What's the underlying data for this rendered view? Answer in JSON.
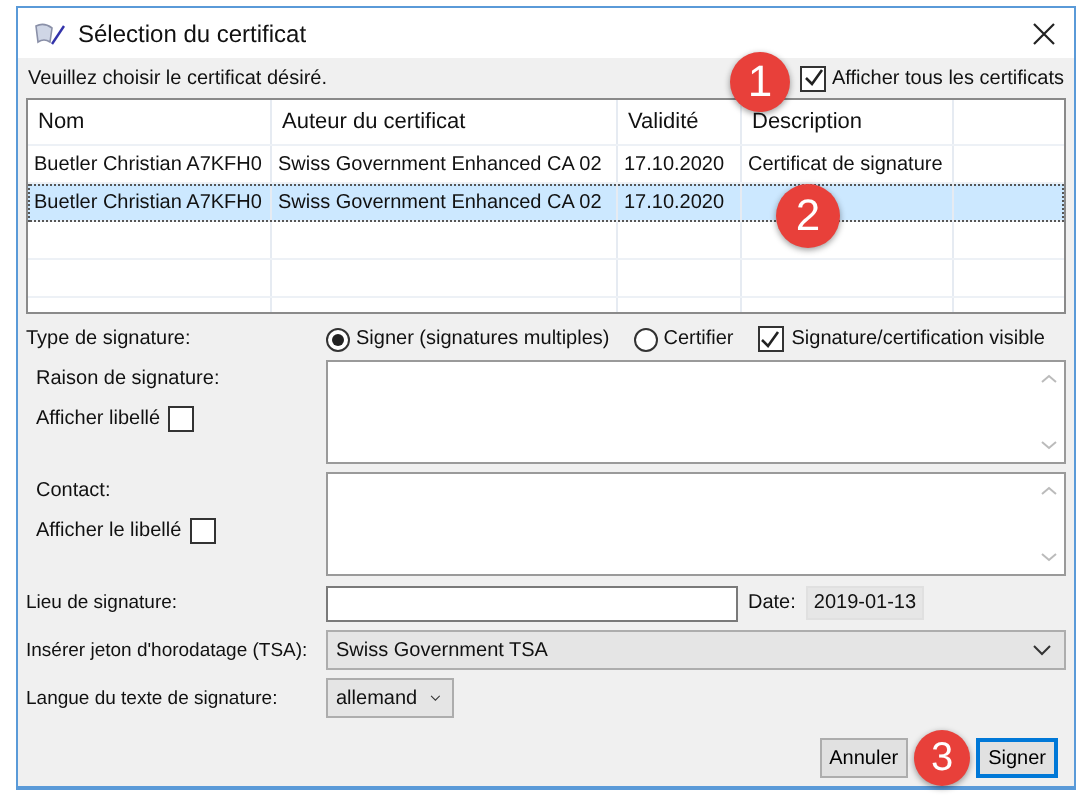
{
  "window": {
    "title": "Sélection du certificat"
  },
  "instruction": "Veuillez choisir le certificat désiré.",
  "show_all": {
    "label": "Afficher tous les certificats",
    "checked": true
  },
  "table": {
    "columns": [
      "Nom",
      "Auteur du certificat",
      "Validité",
      "Description"
    ],
    "rows": [
      {
        "cells": [
          "Buetler Christian A7KFH0",
          "Swiss Government Enhanced CA 02",
          "17.10.2020",
          "Certificat de signature"
        ],
        "selected": false
      },
      {
        "cells": [
          "Buetler Christian A7KFH0",
          "Swiss Government Enhanced CA 02",
          "17.10.2020",
          ""
        ],
        "selected": true
      }
    ]
  },
  "signature_type": {
    "label": "Type de signature:",
    "options": [
      {
        "label": "Signer (signatures multiples)",
        "selected": true
      },
      {
        "label": "Certifier",
        "selected": false
      }
    ],
    "visible": {
      "label": "Signature/certification visible",
      "checked": true
    }
  },
  "reason": {
    "label": "Raison de signature:",
    "show_label": {
      "label": "Afficher libellé",
      "checked": false
    }
  },
  "contact": {
    "label": "Contact:",
    "show_label": {
      "label": "Afficher le libellé",
      "checked": false
    }
  },
  "place": {
    "label": "Lieu de signature:"
  },
  "date": {
    "label": "Date:",
    "value": "2019-01-13"
  },
  "tsa": {
    "label": "Insérer jeton d'horodatage (TSA):",
    "value": "Swiss Government TSA"
  },
  "language": {
    "label": "Langue du texte de signature:",
    "value": "allemand"
  },
  "buttons": [
    {
      "label": "Annuler",
      "default": false
    },
    {
      "label": "Signer",
      "default": true
    }
  ],
  "callouts": [
    "1",
    "2",
    "3"
  ]
}
